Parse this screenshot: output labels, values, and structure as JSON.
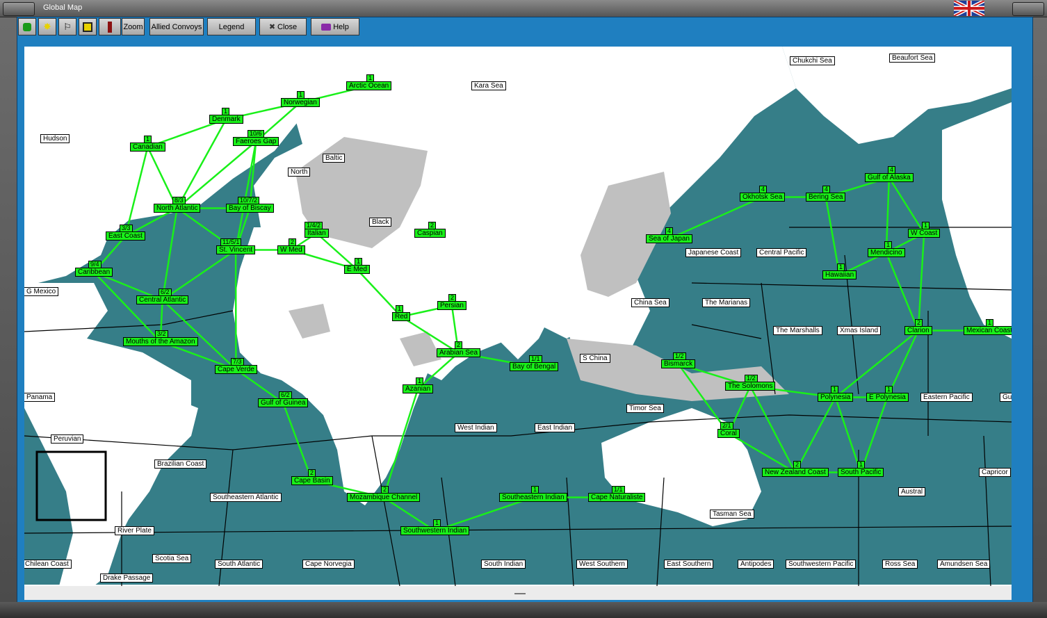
{
  "window": {
    "title": "Global Map"
  },
  "toolbar": {
    "zoom": "Zoom",
    "allied_convoys": "Allied Convoys",
    "legend": "Legend",
    "close": "Close",
    "help": "Help"
  },
  "colors": {
    "ocean": "#367e88",
    "land": "#ffffff",
    "occupied_land": "#c0c0c0",
    "route": "#19f019",
    "frame_blue": "#1f7fc0"
  },
  "sea_labels": [
    "Chukchi Sea",
    "Beaufort Sea",
    "Kara Sea",
    "Hudson",
    "Baltic",
    "North",
    "Black",
    "Japanese Coast",
    "Central Pacific",
    "China Sea",
    "The Marianas",
    "The Marshalls",
    "Xmas Island",
    "G Mexico",
    "S China",
    "Timor Sea",
    "Eastern Pacific",
    "Panama",
    "Peruvian",
    "West Indian",
    "East Indian",
    "Brazilian Coast",
    "Southeastern Atlantic",
    "Austral",
    "Capricor",
    "River Plate",
    "Tasman Sea",
    "Chilean Coast",
    "Scotia Sea",
    "South Atlantic",
    "Cape Norvegia",
    "South Indian",
    "West Southern",
    "East Southern",
    "Antipodes",
    "Southwestern Pacific",
    "Ross Sea",
    "Amundsen Sea",
    "Drake Passage",
    "Gu"
  ],
  "zones": [
    {
      "name": "Arctic Ocean",
      "count": "1"
    },
    {
      "name": "Norwegian",
      "count": "1"
    },
    {
      "name": "Denmark",
      "count": "1"
    },
    {
      "name": "Faeroes Gap",
      "count": "10/6"
    },
    {
      "name": "Canadian",
      "count": "1"
    },
    {
      "name": "North Atlantic",
      "count": "8/3"
    },
    {
      "name": "Bay of Biscay",
      "count": "10/7/2"
    },
    {
      "name": "East Coast",
      "count": "3/3"
    },
    {
      "name": "Italian",
      "count": "1/4/2"
    },
    {
      "name": "Caspian",
      "count": "2"
    },
    {
      "name": "St. Vincent",
      "count": "11/5/1"
    },
    {
      "name": "W Med",
      "count": "2"
    },
    {
      "name": "E Med",
      "count": "1"
    },
    {
      "name": "Caribbean",
      "count": "9/4"
    },
    {
      "name": "Central Atlantic",
      "count": "6/2"
    },
    {
      "name": "Red",
      "count": "1"
    },
    {
      "name": "Persian",
      "count": "2"
    },
    {
      "name": "Mouths of the Amazon",
      "count": "3/2"
    },
    {
      "name": "Arabian Sea",
      "count": "2"
    },
    {
      "name": "Bay of Bengal",
      "count": "1/1"
    },
    {
      "name": "Cape Verde",
      "count": "7/3"
    },
    {
      "name": "Azanian",
      "count": "1"
    },
    {
      "name": "Gulf of Guinea",
      "count": "6/2"
    },
    {
      "name": "Cape Basin",
      "count": "2"
    },
    {
      "name": "Mozambique Channel",
      "count": "2"
    },
    {
      "name": "Southeastern Indian",
      "count": "1"
    },
    {
      "name": "Cape Naturaliste",
      "count": "1/1"
    },
    {
      "name": "Southwestern Indian",
      "count": "1"
    },
    {
      "name": "Sea of Japan",
      "count": "4"
    },
    {
      "name": "Okhotsk Sea",
      "count": "4"
    },
    {
      "name": "Bering Sea",
      "count": "4"
    },
    {
      "name": "Gulf of Alaska",
      "count": "4"
    },
    {
      "name": "W Coast",
      "count": "1"
    },
    {
      "name": "Mendicino",
      "count": "1"
    },
    {
      "name": "Hawaiian",
      "count": "1"
    },
    {
      "name": "Clarion",
      "count": "2"
    },
    {
      "name": "Mexican Coast",
      "count": "1"
    },
    {
      "name": "Bismarck",
      "count": "1/2"
    },
    {
      "name": "The Solomons",
      "count": "1/2"
    },
    {
      "name": "Polynesia",
      "count": "1"
    },
    {
      "name": "E Polynesia",
      "count": "1"
    },
    {
      "name": "Coral",
      "count": "2/1"
    },
    {
      "name": "New Zealand Coast",
      "count": "2"
    },
    {
      "name": "South Pacific",
      "count": "1"
    }
  ]
}
